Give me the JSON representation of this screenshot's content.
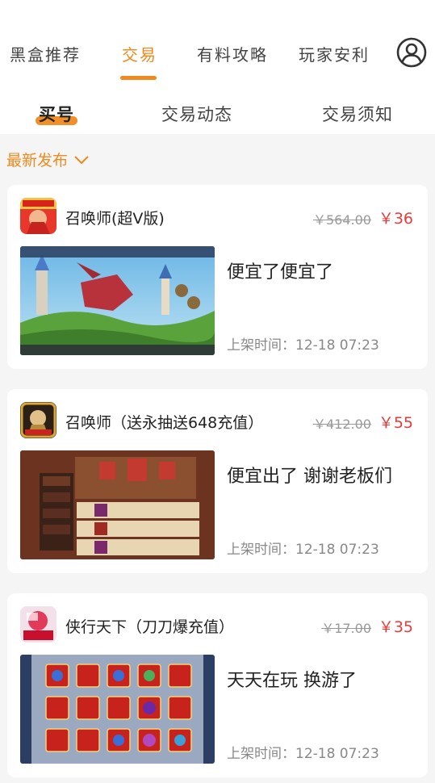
{
  "top_nav": {
    "items": [
      {
        "label": "黑盒推荐",
        "active": false
      },
      {
        "label": "交易",
        "active": true
      },
      {
        "label": "有料攻略",
        "active": false
      },
      {
        "label": "玩家安利",
        "active": false
      }
    ],
    "avatar_icon": "user-circle-icon",
    "accent_color": "#f08a1e"
  },
  "sub_tabs": [
    {
      "label": "买号",
      "active": true
    },
    {
      "label": "交易动态",
      "active": false
    },
    {
      "label": "交易须知",
      "active": false
    }
  ],
  "filter": {
    "label": "最新发布",
    "icon": "chevron-down-icon"
  },
  "listings": [
    {
      "game": "召唤师(超V版)",
      "old_price": "￥564.00",
      "price": "￥36",
      "description": "便宜了便宜了",
      "listed_time": "上架时间：12-18 07:23"
    },
    {
      "game": "召唤师（送永抽送648充值）",
      "old_price": "￥412.00",
      "price": "￥55",
      "description": "便宜出了 谢谢老板们",
      "listed_time": "上架时间：12-18 07:23"
    },
    {
      "game": "侠行天下（刀刀爆充值）",
      "old_price": "￥17.00",
      "price": "￥35",
      "description": "天天在玩 换游了",
      "listed_time": "上架时间：12-18 07:23"
    }
  ]
}
